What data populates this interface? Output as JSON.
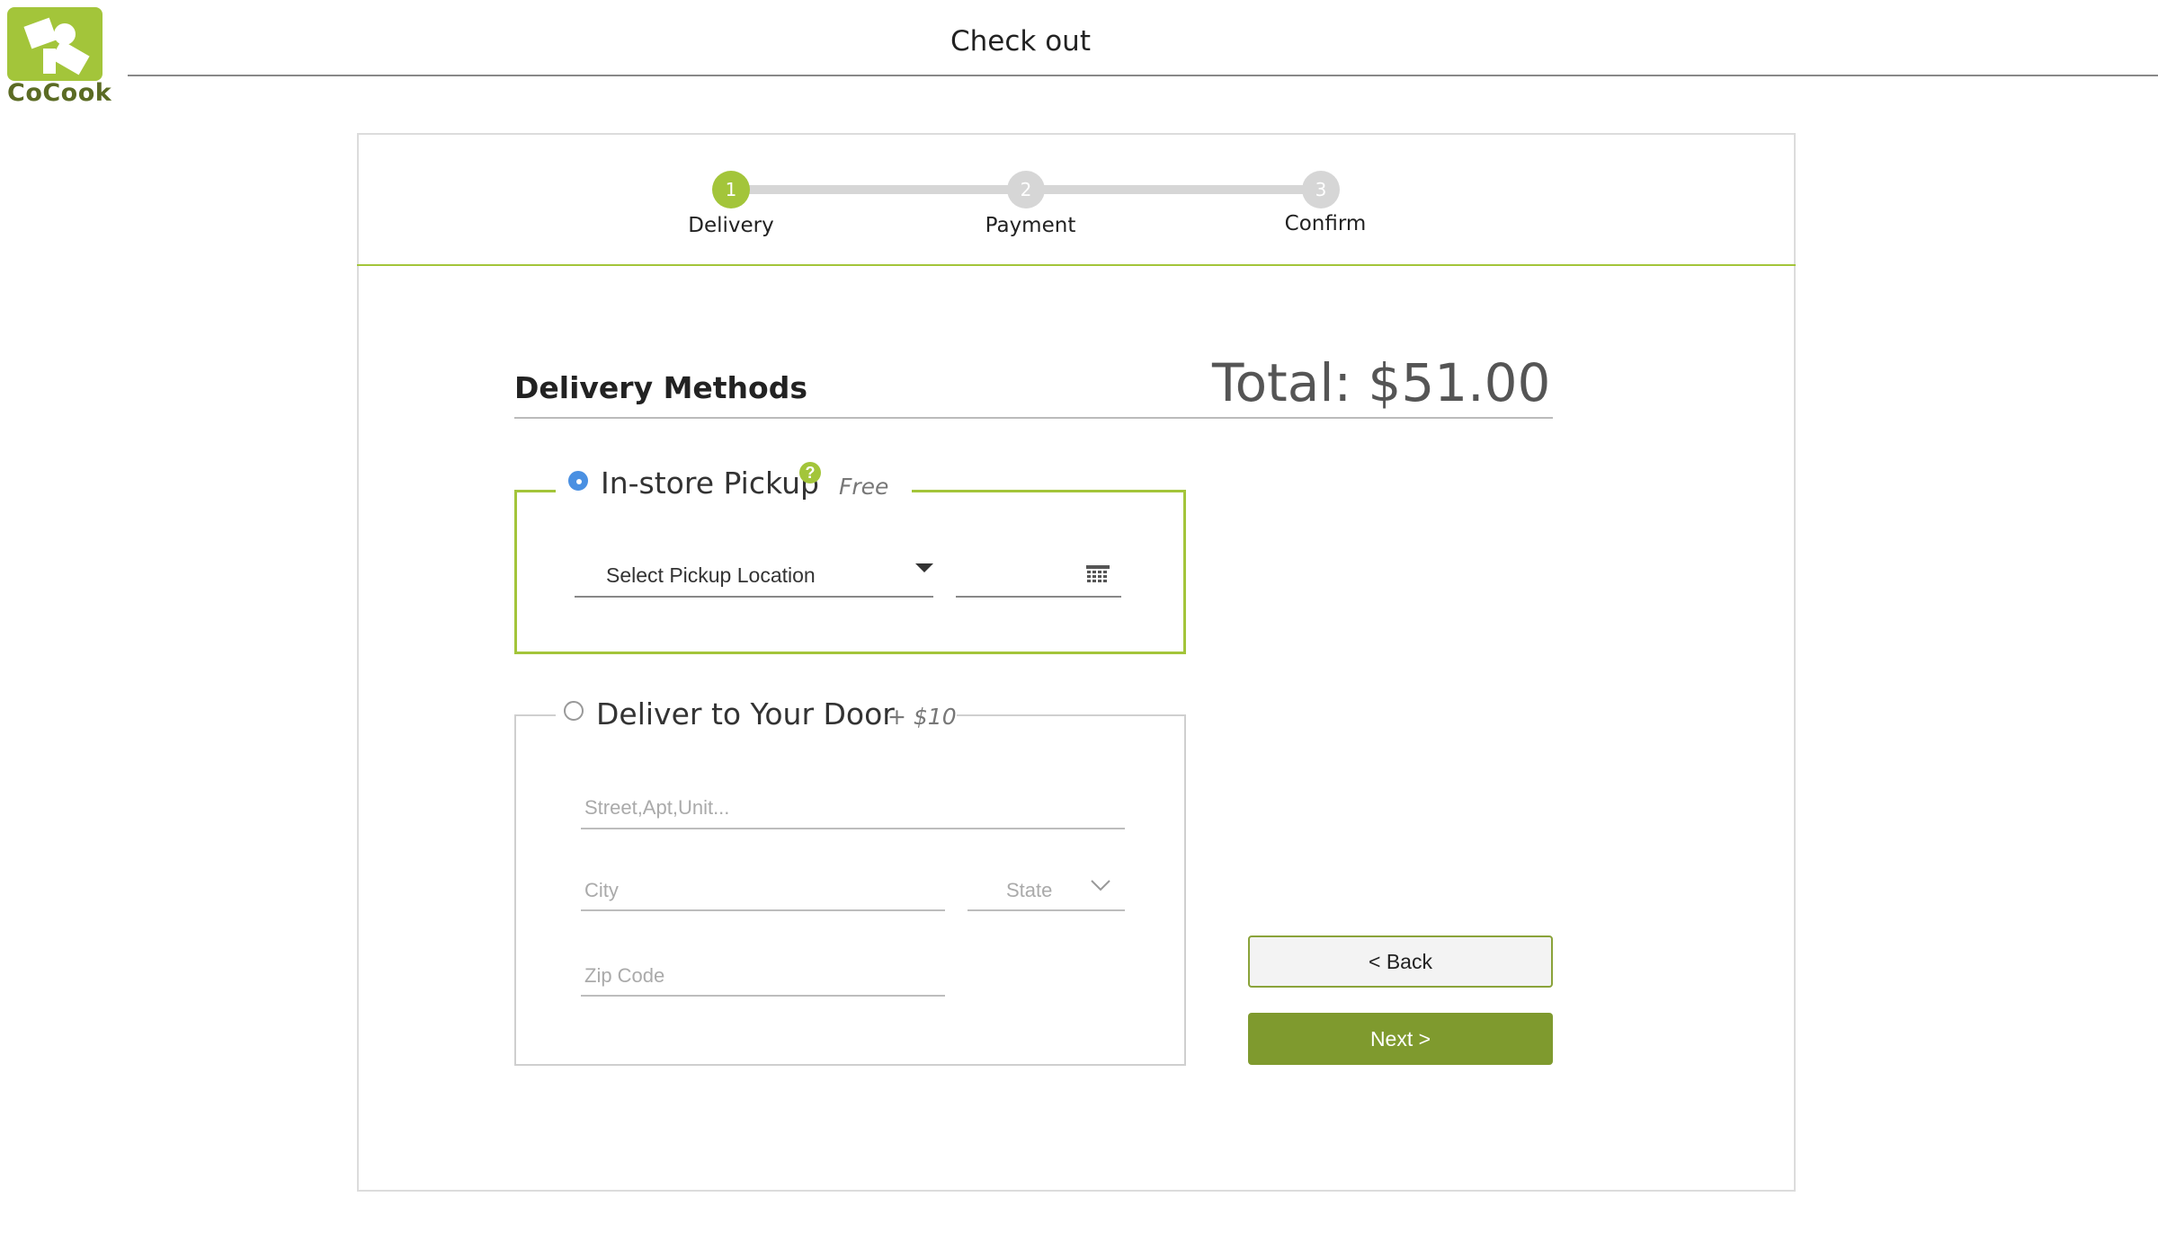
{
  "brand": {
    "logo_text": "CoCook",
    "accent": "#a3c53a",
    "button_green": "#7f9a2e"
  },
  "header": {
    "title": "Check out"
  },
  "stepper": {
    "steps": [
      {
        "number": "1",
        "label": "Delivery",
        "state": "active"
      },
      {
        "number": "2",
        "label": "Payment",
        "state": "inactive"
      },
      {
        "number": "3",
        "label": "Confirm",
        "state": "inactive"
      }
    ]
  },
  "delivery": {
    "section_title": "Delivery Methods",
    "total": "Total: $51.00",
    "pickup": {
      "label": "In-store Pickup",
      "price": "Free",
      "help_icon": "?",
      "selected": true,
      "location_select": "Select Pickup Location",
      "date_icon": "calendar-icon"
    },
    "door": {
      "label": "Deliver to Your Door",
      "price": "+ $10",
      "selected": false,
      "street_placeholder": "Street,Apt,Unit...",
      "city_placeholder": "City",
      "state_placeholder": "State",
      "zip_placeholder": "Zip Code"
    }
  },
  "actions": {
    "back_label": "< Back",
    "next_label": "Next >"
  }
}
